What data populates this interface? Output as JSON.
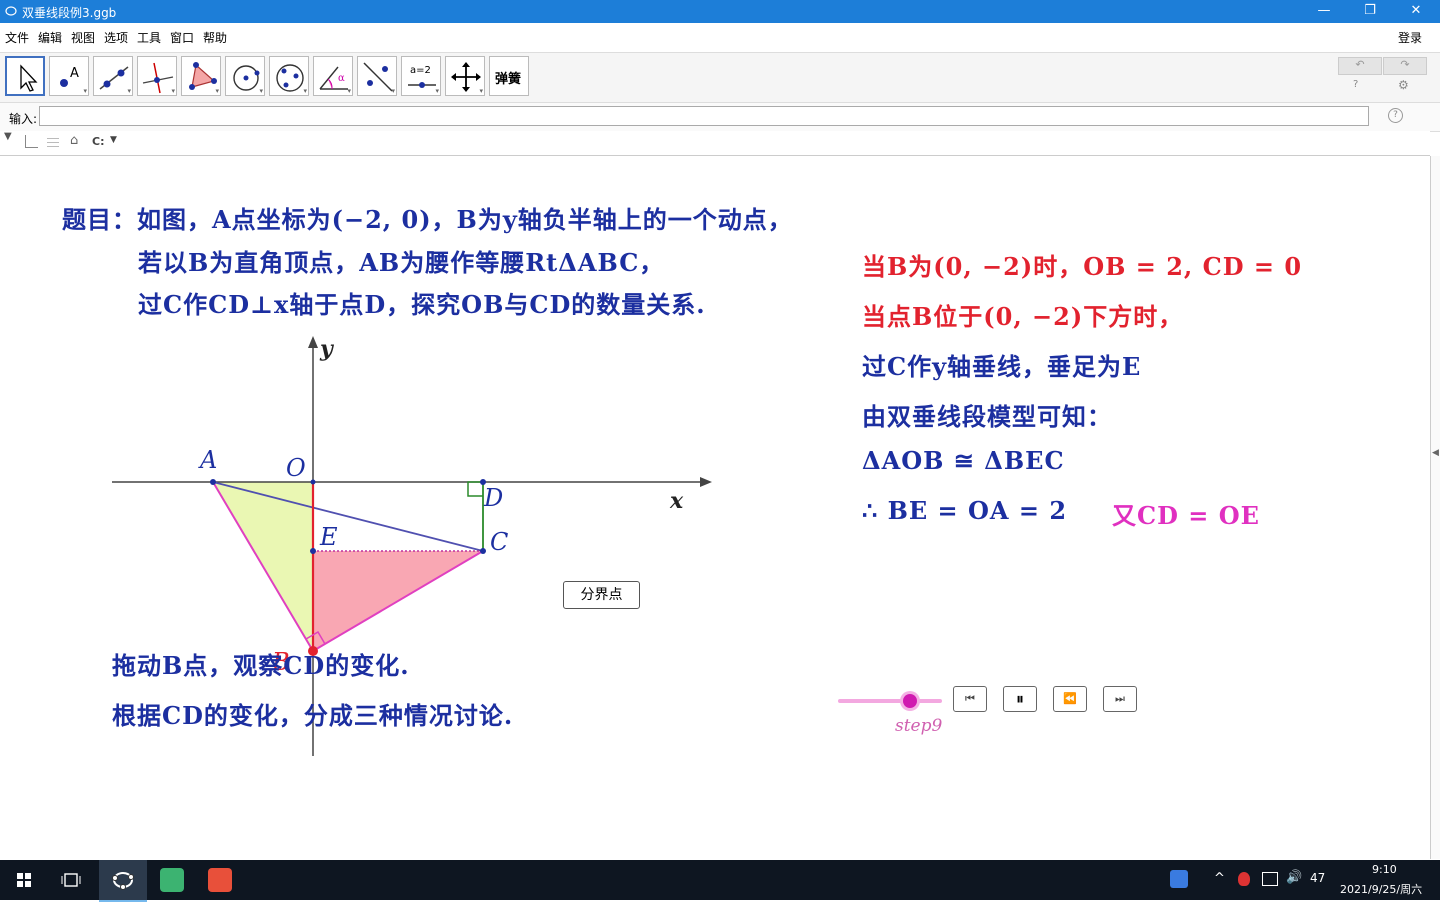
{
  "window": {
    "title": "双垂线段例3.ggb",
    "minimize": "—",
    "maximize": "❐",
    "close": "✕"
  },
  "menu": [
    "文件",
    "编辑",
    "视图",
    "选项",
    "工具",
    "窗口",
    "帮助"
  ],
  "login": "登录",
  "toolbar": {
    "tools": [
      "move-tool",
      "point-tool",
      "line-tool",
      "perpendicular-line-tool",
      "polygon-tool",
      "circle-center-point-tool",
      "circle-three-points-tool",
      "angle-tool",
      "reflect-tool",
      "slider-tool",
      "move-graphics-view-tool",
      "custom-tool"
    ],
    "slider_tool_text": "a=2",
    "custom_tool_text": "弹簧",
    "help_text": "?"
  },
  "input": {
    "label": "输入:",
    "value": ""
  },
  "stylebar": {
    "point_capture_label": "C:"
  },
  "problem": {
    "line1": "题目：如图，A点坐标为(−2, 0)，B为y轴负半轴上的一个动点，",
    "line2": "若以B为直角顶点，AB为腰作等腰RtΔABC，",
    "line3": "过C作CD⊥x轴于点D，探究OB与CD的数量关系."
  },
  "hints": {
    "line1": "拖动B点，观察CD的变化.",
    "line2": "根据CD的变化，分成三种情况讨论."
  },
  "solution": {
    "line1": "当B为(0, −2)时，OB = 2, CD = 0",
    "line2": "当点B位于(0, −2)下方时，",
    "line3": "过C作y轴垂线，垂足为E",
    "line4": "由双垂线段模型可知：",
    "line5": "ΔAOB ≅ ΔBEC",
    "line6a": "∴ BE = OA = 2",
    "line6b": "又CD = OE"
  },
  "figure": {
    "labels": {
      "A": "A",
      "O": "O",
      "D": "D",
      "E": "E",
      "C": "C",
      "B": "B",
      "x": "x",
      "y": "y"
    }
  },
  "button_label": "分界点",
  "slider": {
    "caption": "step9"
  },
  "nav_buttons": [
    "⏮",
    "⏸",
    "⏪",
    "⏭"
  ],
  "taskbar": {
    "clock_time": "9:10",
    "clock_date": "2021/9/25/周六",
    "tray_number": "47",
    "tray_chevron": "^"
  },
  "colors": {
    "titlebar": "#1d7ed8",
    "blue_text": "#1c2fa0",
    "red_text": "#e2222e",
    "pink_text": "#e030c0"
  }
}
